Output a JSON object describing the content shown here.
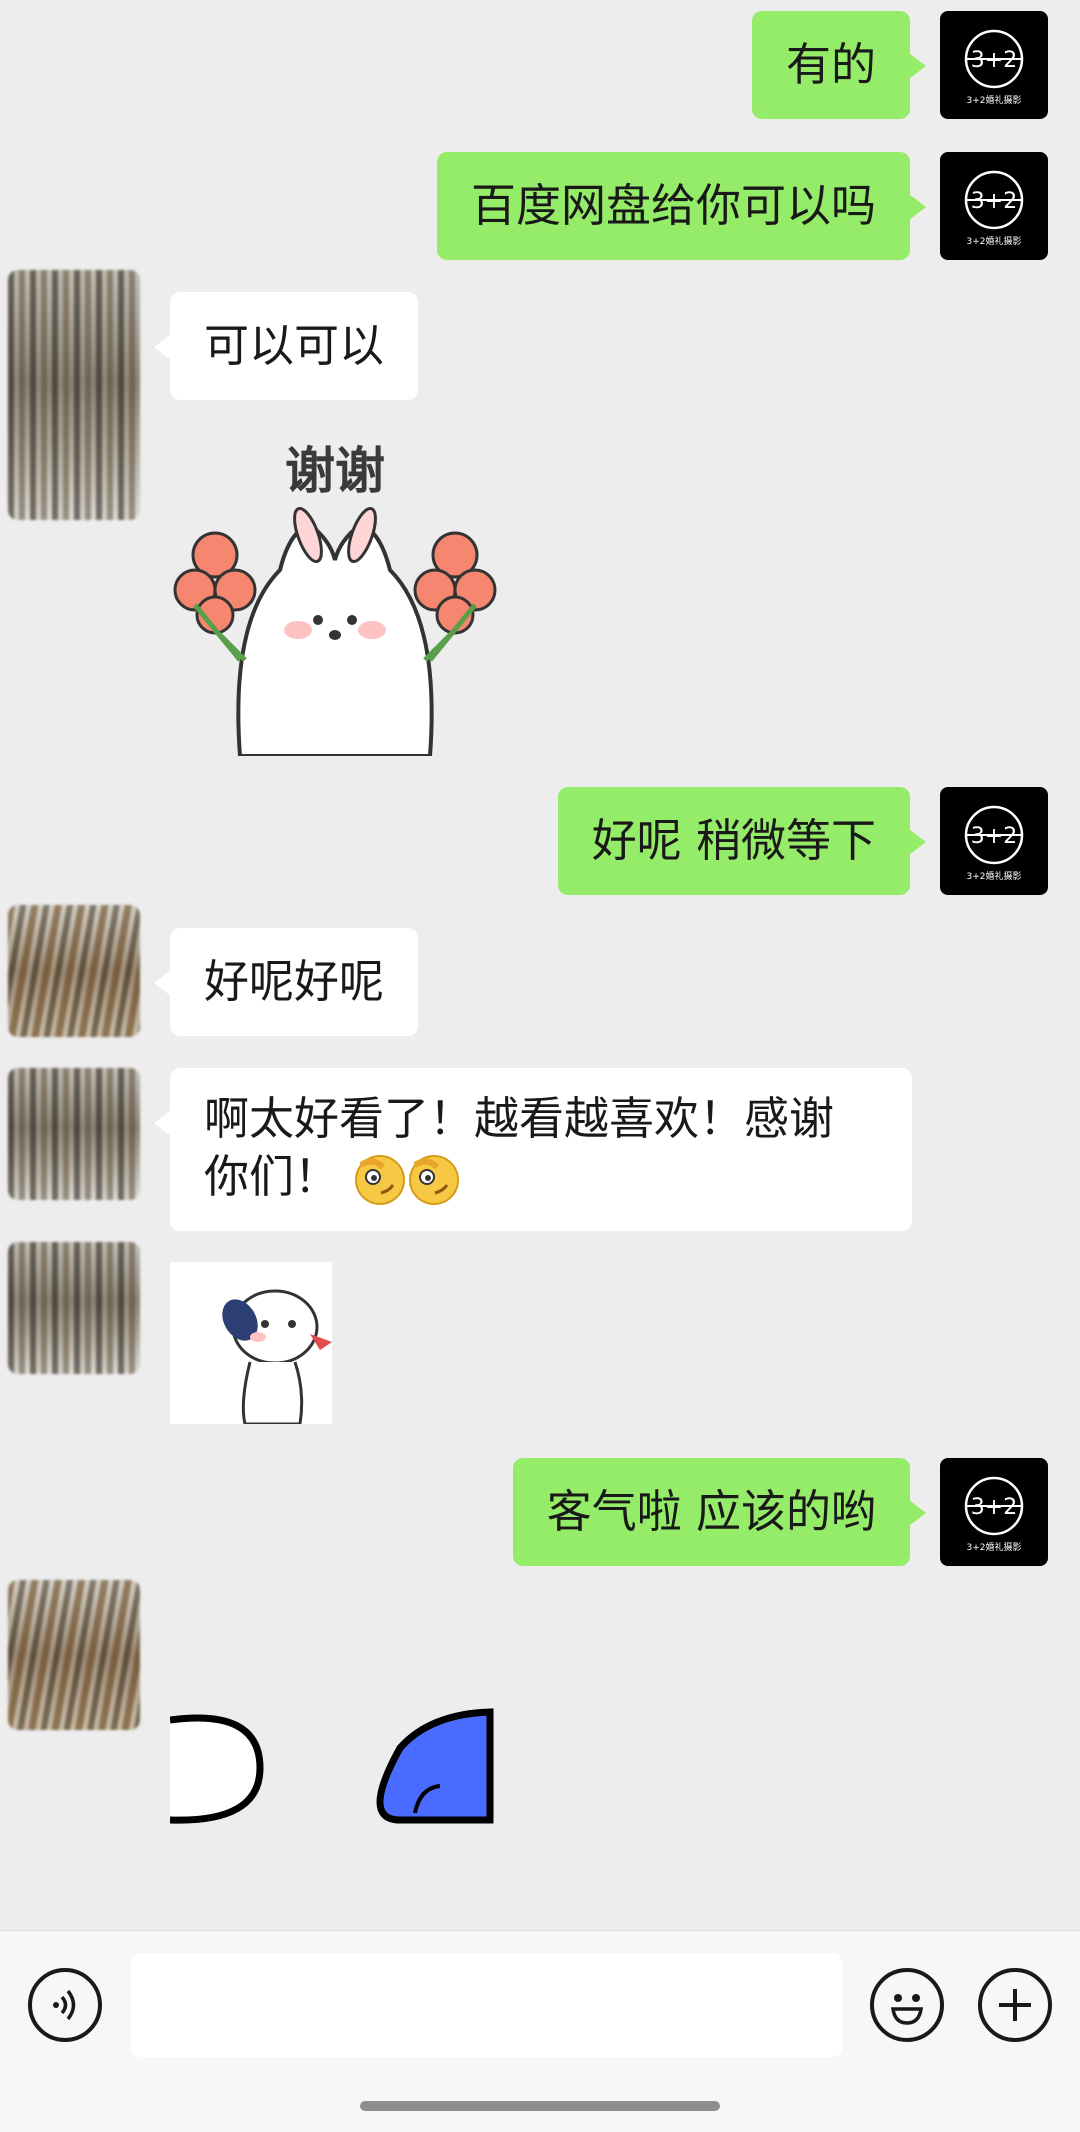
{
  "chat": {
    "messages": [
      {
        "sender": "me",
        "text": "有的"
      },
      {
        "sender": "me",
        "text": "百度网盘给你可以吗"
      },
      {
        "sender": "other",
        "text": "可以可以"
      },
      {
        "sender": "other",
        "type": "sticker",
        "text": "谢谢"
      },
      {
        "sender": "me",
        "text": "好呢 稍微等下"
      },
      {
        "sender": "other",
        "text": "好呢好呢"
      },
      {
        "sender": "other",
        "text": "啊太好看了！越看越喜欢！感谢你们！",
        "emoji": "salute-face-emoji ×2"
      },
      {
        "sender": "other",
        "type": "sticker",
        "text": ""
      },
      {
        "sender": "me",
        "text": "客气啦 应该的哟"
      },
      {
        "sender": "other",
        "type": "sticker",
        "text": ""
      }
    ]
  },
  "my_avatar": {
    "logo_text": "3+2婚礼摄影"
  },
  "input": {
    "placeholder": "",
    "value": ""
  },
  "icons": {
    "voice": "voice-icon",
    "emoji": "emoji-icon",
    "more": "plus-icon"
  },
  "colors": {
    "bg": "#ededed",
    "my_bubble": "#95ec69",
    "their_bubble": "#ffffff"
  }
}
